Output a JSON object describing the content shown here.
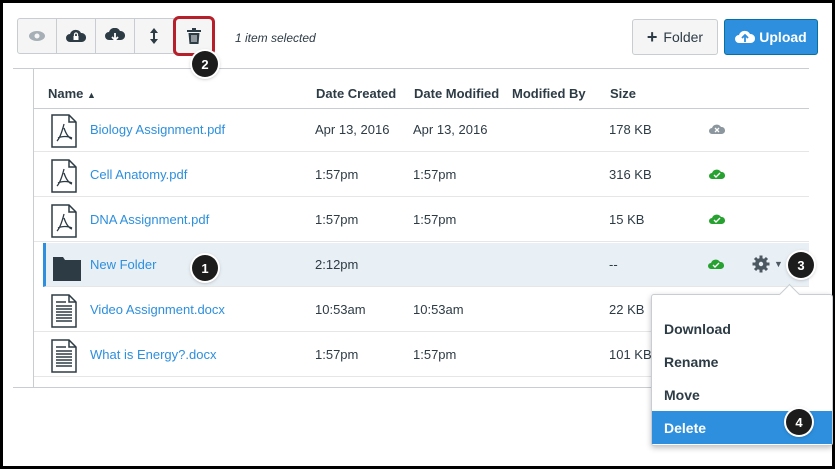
{
  "toolbar": {
    "selected_text": "1 item selected",
    "buttons": [
      {
        "name": "preview",
        "icon": "eye-icon"
      },
      {
        "name": "restrict-access",
        "icon": "cloud-lock-icon"
      },
      {
        "name": "download",
        "icon": "cloud-download-icon"
      },
      {
        "name": "move",
        "icon": "move-vertical-icon"
      },
      {
        "name": "delete",
        "icon": "trash-icon"
      }
    ],
    "folder_label": "Folder",
    "upload_label": "Upload"
  },
  "columns": {
    "name": "Name",
    "date_created": "Date Created",
    "date_modified": "Date Modified",
    "modified_by": "Modified By",
    "size": "Size"
  },
  "files": [
    {
      "name": "Biology Assignment.pdf",
      "type": "pdf",
      "created": "Apr 13, 2016",
      "modified": "Apr 13, 2016",
      "modified_by": "",
      "size": "178 KB",
      "status": "unpublished"
    },
    {
      "name": "Cell Anatomy.pdf",
      "type": "pdf",
      "created": "1:57pm",
      "modified": "1:57pm",
      "modified_by": "",
      "size": "316 KB",
      "status": "published"
    },
    {
      "name": "DNA Assignment.pdf",
      "type": "pdf",
      "created": "1:57pm",
      "modified": "1:57pm",
      "modified_by": "",
      "size": "15 KB",
      "status": "published"
    },
    {
      "name": "New Folder",
      "type": "folder",
      "created": "2:12pm",
      "modified": "",
      "modified_by": "",
      "size": "--",
      "status": "published",
      "selected": true
    },
    {
      "name": "Video Assignment.docx",
      "type": "doc",
      "created": "10:53am",
      "modified": "10:53am",
      "modified_by": "",
      "size": "22 KB",
      "status": "published"
    },
    {
      "name": "What is Energy?.docx",
      "type": "doc",
      "created": "1:57pm",
      "modified": "1:57pm",
      "modified_by": "",
      "size": "101 KB",
      "status": "published"
    }
  ],
  "menu": {
    "items": [
      "Download",
      "Rename",
      "Move",
      "Delete"
    ],
    "active": "Delete"
  },
  "callouts": [
    "1",
    "2",
    "3",
    "4"
  ],
  "colors": {
    "accent": "#2d8fdd",
    "published": "#27a12f",
    "unpublished": "#8b969e",
    "highlight": "#b5202a"
  }
}
